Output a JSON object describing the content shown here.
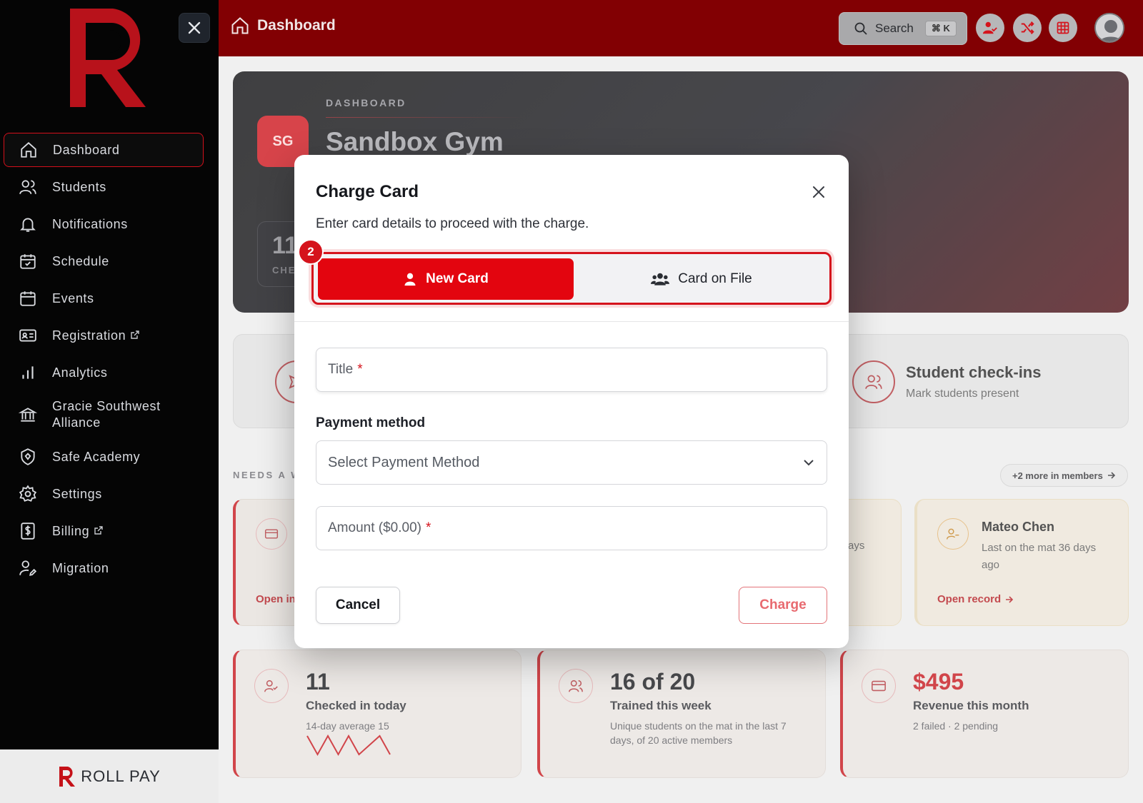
{
  "sidebar": {
    "items": [
      {
        "label": "Dashboard",
        "icon": "home-icon",
        "active": true
      },
      {
        "label": "Students",
        "icon": "users-icon"
      },
      {
        "label": "Notifications",
        "icon": "bell-icon"
      },
      {
        "label": "Schedule",
        "icon": "calendar-check-icon"
      },
      {
        "label": "Events",
        "icon": "calendar-icon"
      },
      {
        "label": "Registration",
        "icon": "id-card-icon",
        "external": true
      },
      {
        "label": "Analytics",
        "icon": "bar-chart-icon"
      },
      {
        "label": "Gracie Southwest Alliance",
        "icon": "bank-icon"
      },
      {
        "label": "Safe Academy",
        "icon": "shield-icon"
      },
      {
        "label": "Settings",
        "icon": "gear-icon"
      },
      {
        "label": "Billing",
        "icon": "dollar-doc-icon",
        "external": true
      },
      {
        "label": "Migration",
        "icon": "user-edit-icon"
      }
    ],
    "footer_brand": "ROLL PAY"
  },
  "topbar": {
    "title": "Dashboard",
    "search_label": "Search",
    "search_shortcut": "⌘ K"
  },
  "hero": {
    "label": "DASHBOARD",
    "initials": "SG",
    "gym_name": "Sandbox Gym",
    "stat_value": "11",
    "stat_label": "CHE"
  },
  "quick_action": {
    "title": "Student check-ins",
    "subtitle": "Mark students present"
  },
  "needs": {
    "label": "NEEDS A WO",
    "more_link": "+2 more in members",
    "card1_link": "Open in",
    "card3_fragment": "ays",
    "card4": {
      "name": "Mateo Chen",
      "sub": "Last on the mat 36 days ago",
      "link": "Open record"
    }
  },
  "stats": [
    {
      "value": "11",
      "label": "Checked in today",
      "sub": "14-day average 15",
      "sparkline": [
        3,
        1,
        3,
        1,
        3,
        1,
        2,
        3,
        1
      ]
    },
    {
      "value": "16 of 20",
      "label": "Trained this week",
      "sub": "Unique students on the mat in the last 7 days, of 20 active members"
    },
    {
      "value": "$495",
      "label": "Revenue this month",
      "sub": "2 failed · 2 pending"
    }
  ],
  "modal": {
    "title": "Charge Card",
    "description": "Enter card details to proceed with the charge.",
    "step_badge": "2",
    "tabs": [
      {
        "label": "New Card",
        "selected": true
      },
      {
        "label": "Card on File",
        "selected": false
      }
    ],
    "title_placeholder": "Title",
    "required_mark": "*",
    "payment_label": "Payment method",
    "payment_placeholder": "Select Payment Method",
    "amount_placeholder": "Amount ($0.00)",
    "cancel_label": "Cancel",
    "charge_label": "Charge"
  },
  "colors": {
    "accent": "#e3050f",
    "topbar": "#820003",
    "sidebar": "#050505"
  }
}
